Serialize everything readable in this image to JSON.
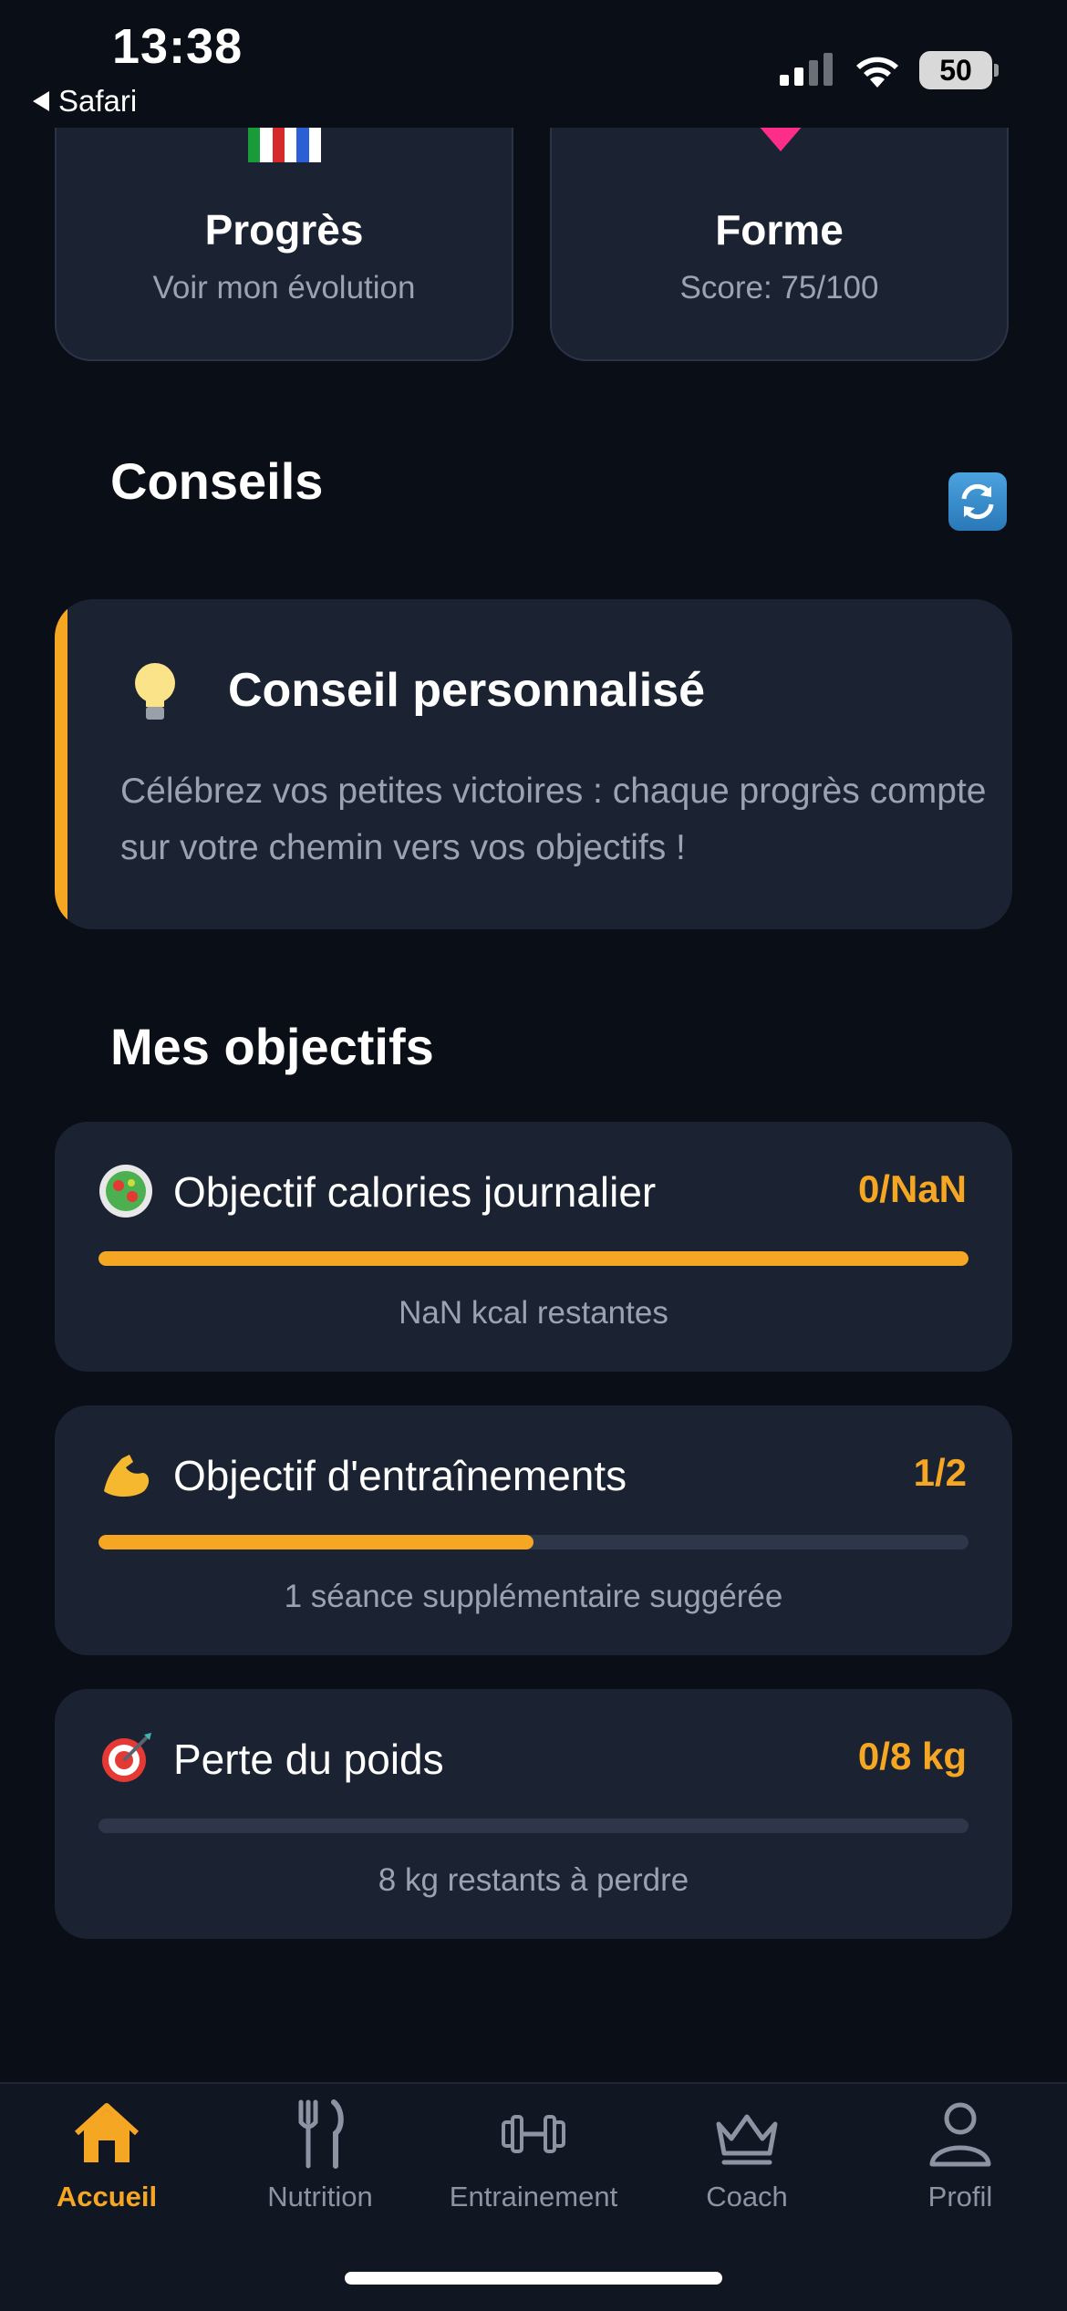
{
  "status_bar": {
    "time": "13:38",
    "back_app": "Safari",
    "battery": "50"
  },
  "top_cards": [
    {
      "title": "Progrès",
      "subtitle": "Voir mon évolution",
      "icon": "medal-ribbon-icon"
    },
    {
      "title": "Forme",
      "subtitle": "Score: 75/100",
      "icon": "heart-icon"
    }
  ],
  "tips": {
    "section_title": "Conseils",
    "refresh_icon": "refresh-icon",
    "card_title": "Conseil personnalisé",
    "card_text": "Célébrez vos petites victoires : chaque progrès compte sur votre chemin vers vos objectifs !"
  },
  "goals": {
    "section_title": "Mes objectifs",
    "items": [
      {
        "label": "Objectif calories journalier",
        "value": "0/NaN",
        "note": "NaN kcal restantes",
        "progress": 1.0,
        "icon": "salad-icon"
      },
      {
        "label": "Objectif d'entraînements",
        "value": "1/2",
        "note": "1 séance supplémentaire suggérée",
        "progress": 0.5,
        "icon": "flexed-biceps-icon"
      },
      {
        "label": "Perte du poids",
        "value": "0/8 kg",
        "note": "8 kg restants à perdre",
        "progress": 0.0,
        "icon": "target-icon"
      }
    ]
  },
  "tabbar": {
    "items": [
      {
        "label": "Accueil",
        "icon": "home-icon",
        "active": true
      },
      {
        "label": "Nutrition",
        "icon": "fork-knife-icon",
        "active": false
      },
      {
        "label": "Entrainement",
        "icon": "dumbbell-icon",
        "active": false
      },
      {
        "label": "Coach",
        "icon": "crown-icon",
        "active": false
      },
      {
        "label": "Profil",
        "icon": "user-icon",
        "active": false
      }
    ]
  },
  "colors": {
    "accent": "#f5a623",
    "background": "#0a0e17",
    "card": "#1b2333",
    "muted_text": "#9aa3b2"
  }
}
